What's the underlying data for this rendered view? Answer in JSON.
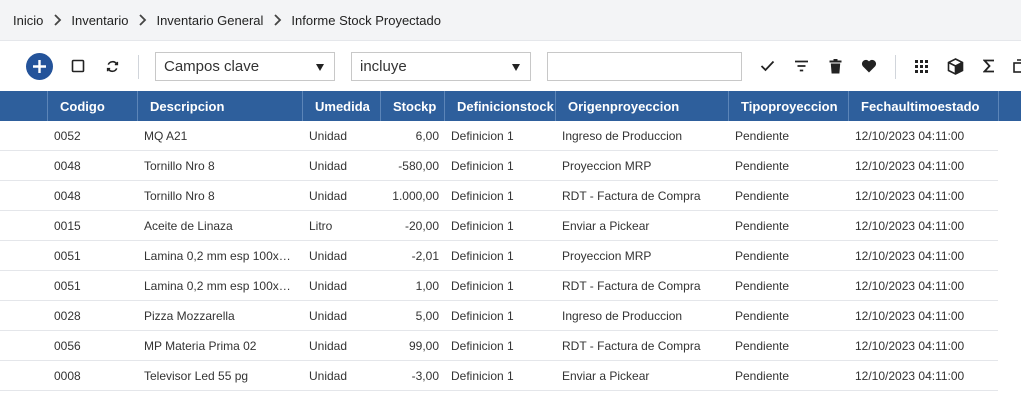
{
  "breadcrumb": [
    "Inicio",
    "Inventario",
    "Inventario General",
    "Informe Stock Proyectado"
  ],
  "toolbar": {
    "field_select": "Campos clave",
    "operator_select": "incluye",
    "search_value": ""
  },
  "colors": {
    "header_bg": "#2e5f9c",
    "accent": "#24539a",
    "breadcrumb_bg": "#f3f4f6"
  },
  "columns": [
    "Codigo",
    "Descripcion",
    "Umedida",
    "Stockp",
    "Definicionstock",
    "Origenproyeccion",
    "Tipoproyeccion",
    "Fechaultimoestado"
  ],
  "rows": [
    [
      "0052",
      "MQ A21",
      "Unidad",
      "6,00",
      "Definicion 1",
      "Ingreso de Produccion",
      "Pendiente",
      "12/10/2023 04:11:00"
    ],
    [
      "0048",
      "Tornillo Nro 8",
      "Unidad",
      "-580,00",
      "Definicion 1",
      "Proyeccion MRP",
      "Pendiente",
      "12/10/2023 04:11:00"
    ],
    [
      "0048",
      "Tornillo Nro 8",
      "Unidad",
      "1.000,00",
      "Definicion 1",
      "RDT - Factura de Compra",
      "Pendiente",
      "12/10/2023 04:11:00"
    ],
    [
      "0015",
      "Aceite de Linaza",
      "Litro",
      "-20,00",
      "Definicion 1",
      "Enviar a Pickear",
      "Pendiente",
      "12/10/2023 04:11:00"
    ],
    [
      "0051",
      "Lamina 0,2 mm esp 100x1…",
      "Unidad",
      "-2,01",
      "Definicion 1",
      "Proyeccion MRP",
      "Pendiente",
      "12/10/2023 04:11:00"
    ],
    [
      "0051",
      "Lamina 0,2 mm esp 100x1…",
      "Unidad",
      "1,00",
      "Definicion 1",
      "RDT - Factura de Compra",
      "Pendiente",
      "12/10/2023 04:11:00"
    ],
    [
      "0028",
      "Pizza Mozzarella",
      "Unidad",
      "5,00",
      "Definicion 1",
      "Ingreso de Produccion",
      "Pendiente",
      "12/10/2023 04:11:00"
    ],
    [
      "0056",
      "MP Materia Prima 02",
      "Unidad",
      "99,00",
      "Definicion 1",
      "RDT - Factura de Compra",
      "Pendiente",
      "12/10/2023 04:11:00"
    ],
    [
      "0008",
      "Televisor Led 55 pg",
      "Unidad",
      "-3,00",
      "Definicion 1",
      "Enviar a Pickear",
      "Pendiente",
      "12/10/2023 04:11:00"
    ]
  ]
}
